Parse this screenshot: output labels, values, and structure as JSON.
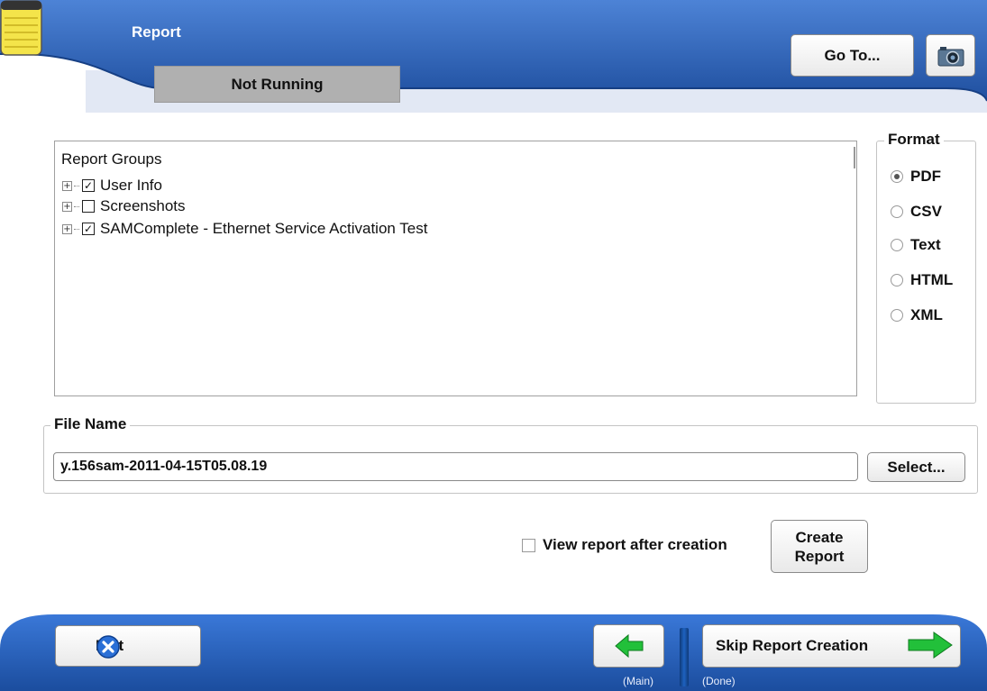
{
  "header": {
    "title": "Report",
    "status": "Not Running",
    "goto_label": "Go To..."
  },
  "report_groups": {
    "header": "Report Groups",
    "items": [
      {
        "label": "User Info",
        "checked": true
      },
      {
        "label": "Screenshots",
        "checked": false
      },
      {
        "label": "SAMComplete - Ethernet Service Activation Test",
        "checked": true
      }
    ]
  },
  "format": {
    "legend": "Format",
    "options": [
      "PDF",
      "CSV",
      "Text",
      "HTML",
      "XML"
    ],
    "selected": "PDF"
  },
  "file": {
    "legend": "File Name",
    "value": "y.156sam-2011-04-15T05.08.19",
    "select_label": "Select..."
  },
  "view_report_label": "View report after creation",
  "create_report": {
    "line1": "Create",
    "line2": "Report"
  },
  "footer": {
    "exit_label": "Exit",
    "back_sublabel": "(Main)",
    "skip_label": "Skip Report Creation",
    "skip_sublabel": "(Done)"
  },
  "icons": {
    "app": "notepad-icon",
    "camera": "camera-icon",
    "exit": "close-circle-icon",
    "back": "arrow-left-icon",
    "skip": "arrow-right-icon"
  },
  "colors": {
    "header_blue": "#2a5fb0",
    "footer_blue": "#2a65c4",
    "accent_green": "#22c03a",
    "status_gray": "#b0b0b0"
  }
}
